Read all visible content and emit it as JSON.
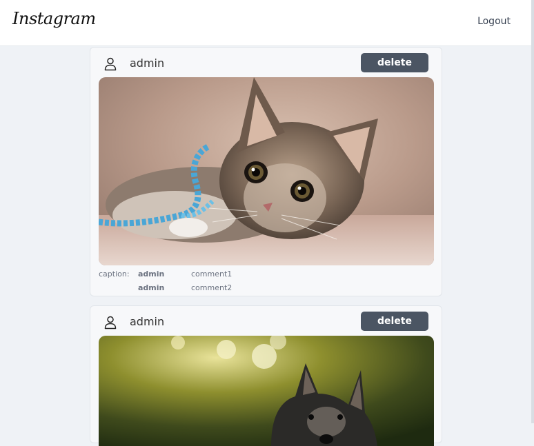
{
  "header": {
    "brand": "Instagram",
    "logout_label": "Logout"
  },
  "posts": [
    {
      "username": "admin",
      "delete_label": "delete",
      "image_subject": "kitten",
      "caption_label": "caption:",
      "comments": [
        {
          "user": "admin",
          "text": "comment1"
        },
        {
          "user": "admin",
          "text": "comment2"
        }
      ]
    },
    {
      "username": "admin",
      "delete_label": "delete",
      "image_subject": "dog"
    }
  ],
  "icons": {
    "user": "user-icon"
  },
  "colors": {
    "page_bg": "#eff2f6",
    "card_bg": "#f7f8fa",
    "delete_button": "#4b5563",
    "text_muted": "#6b7280"
  }
}
